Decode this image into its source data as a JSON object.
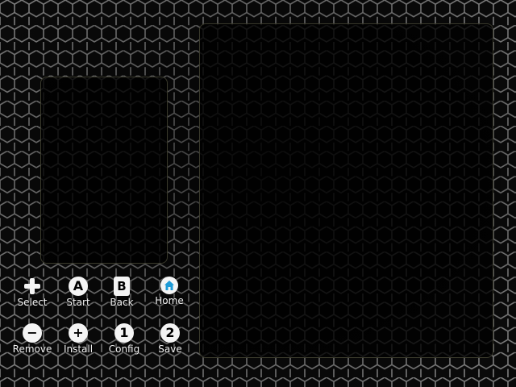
{
  "colors": {
    "background": "#080808",
    "panel_border": "#3a3a2c",
    "home_accent": "#1e9bd7"
  },
  "hints_row1": [
    {
      "icon": "dpad-icon",
      "label": "Select"
    },
    {
      "icon": "a-button-icon",
      "glyph": "A",
      "label": "Start"
    },
    {
      "icon": "b-button-icon",
      "glyph": "B",
      "label": "Back"
    },
    {
      "icon": "home-icon",
      "label": "Home"
    }
  ],
  "hints_row2": [
    {
      "icon": "minus-button-icon",
      "glyph": "−",
      "label": "Remove"
    },
    {
      "icon": "plus-button-icon",
      "glyph": "+",
      "label": "Install"
    },
    {
      "icon": "one-button-icon",
      "glyph": "1",
      "label": "Config"
    },
    {
      "icon": "two-button-icon",
      "glyph": "2",
      "label": "Save"
    }
  ]
}
